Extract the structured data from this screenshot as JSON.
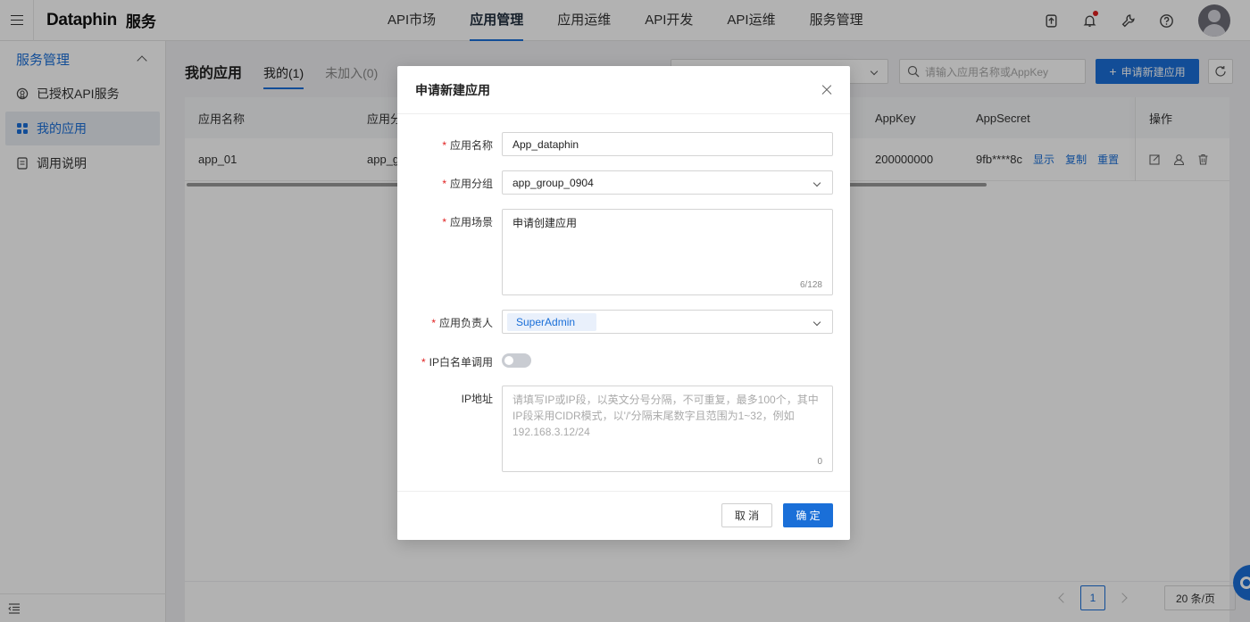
{
  "app": {
    "brand": "Dataphin",
    "module": "服务"
  },
  "topnav": [
    {
      "label": "API市场"
    },
    {
      "label": "应用管理",
      "active": true
    },
    {
      "label": "应用运维"
    },
    {
      "label": "API开发"
    },
    {
      "label": "API运维"
    },
    {
      "label": "服务管理"
    }
  ],
  "sidebar": {
    "section": "服务管理",
    "items": [
      {
        "label": "已授权API服务"
      },
      {
        "label": "我的应用",
        "active": true
      },
      {
        "label": "调用说明"
      }
    ]
  },
  "page": {
    "title": "我的应用",
    "tabs": [
      {
        "label": "我的(1)"
      },
      {
        "label": "未加入(0)"
      }
    ],
    "search_placeholder": "请输入应用名称或AppKey",
    "add_button": "申请新建应用"
  },
  "table": {
    "headers": {
      "name": "应用名称",
      "group": "应用分",
      "appkey": "AppKey",
      "appsecret": "AppSecret",
      "ops": "操作"
    },
    "rows": [
      {
        "name": "app_01",
        "group": "app_g",
        "appkey": "200000000",
        "appsecret": "9fb****8c",
        "show": "显示",
        "copy": "复制",
        "reset": "重置"
      }
    ]
  },
  "pagination": {
    "current": "1",
    "page_size": "20 条/页"
  },
  "modal": {
    "title": "申请新建应用",
    "fields": {
      "name": {
        "label": "应用名称",
        "value": "App_dataphin"
      },
      "group": {
        "label": "应用分组",
        "value": "app_group_0904"
      },
      "scene": {
        "label": "应用场景",
        "value": "申请创建应用",
        "count": "6/128"
      },
      "owner": {
        "label": "应用负责人",
        "tag": "SuperAdmin"
      },
      "ip_whitelist": {
        "label": "IP白名单调用",
        "enabled": false
      },
      "ip_address": {
        "label": "IP地址",
        "placeholder": "请填写IP或IP段，以英文分号分隔，不可重复，最多100个，其中IP段采用CIDR模式，以'/'分隔末尾数字且范围为1~32，例如192.168.3.12/24",
        "count": "0"
      }
    },
    "cancel": "取 消",
    "confirm": "确 定"
  },
  "colors": {
    "primary": "#1a6fd8",
    "required": "#e02020"
  }
}
